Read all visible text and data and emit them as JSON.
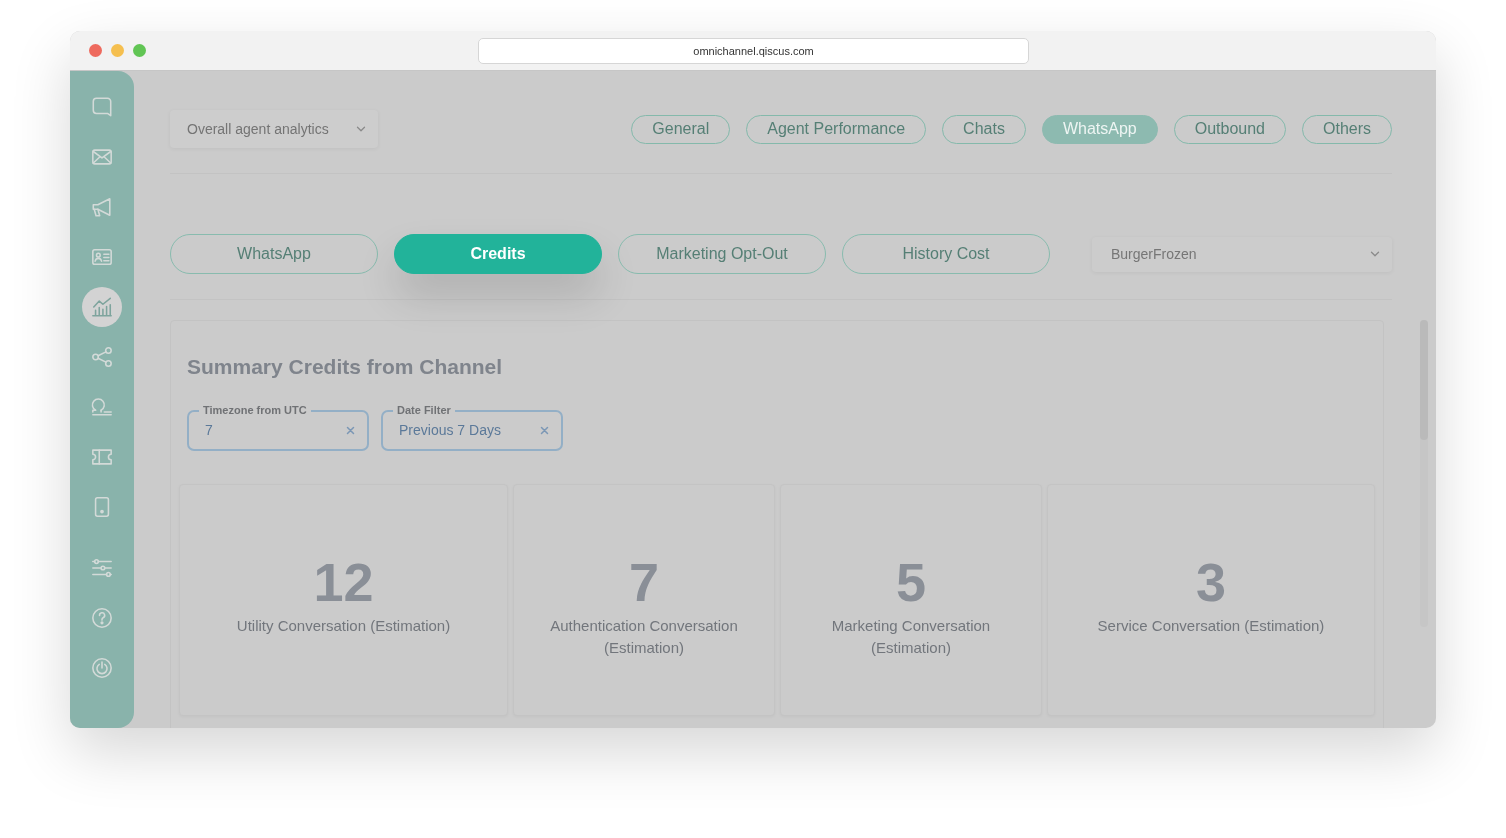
{
  "browser": {
    "url": "omnichannel.qiscus.com"
  },
  "sidebar": {
    "items": [
      {
        "selected": false
      },
      {
        "selected": false
      },
      {
        "selected": false
      },
      {
        "selected": false
      },
      {
        "selected": true
      },
      {
        "selected": false
      },
      {
        "selected": false
      },
      {
        "selected": false
      },
      {
        "selected": false
      }
    ],
    "footer_items": [
      {
        "selected": false
      },
      {
        "selected": false
      },
      {
        "selected": false
      }
    ]
  },
  "analytics_select": {
    "value": "Overall agent analytics"
  },
  "category_tabs": [
    {
      "label": "General",
      "selected": false
    },
    {
      "label": "Agent Performance",
      "selected": false
    },
    {
      "label": "Chats",
      "selected": false
    },
    {
      "label": "WhatsApp",
      "selected": true
    },
    {
      "label": "Outbound",
      "selected": false
    },
    {
      "label": "Others",
      "selected": false
    }
  ],
  "channel_tabs": [
    {
      "label": "WhatsApp",
      "selected": false
    },
    {
      "label": "Credits",
      "selected": true
    },
    {
      "label": "Marketing Opt-Out",
      "selected": false
    },
    {
      "label": "History Cost",
      "selected": false
    }
  ],
  "account_select": {
    "value": "BurgerFrozen"
  },
  "summary": {
    "title": "Summary Credits from Channel",
    "filters": [
      {
        "label": "Timezone from UTC",
        "value": "7"
      },
      {
        "label": "Date Filter",
        "value": "Previous 7 Days"
      }
    ],
    "stats": [
      {
        "value": "12",
        "label": "Utility Conversation (Estimation)"
      },
      {
        "value": "7",
        "label": "Authentication Conversation (Estimation)"
      },
      {
        "value": "5",
        "label": "Marketing Conversation (Estimation)"
      },
      {
        "value": "3",
        "label": "Service Conversation (Estimation)"
      }
    ]
  }
}
